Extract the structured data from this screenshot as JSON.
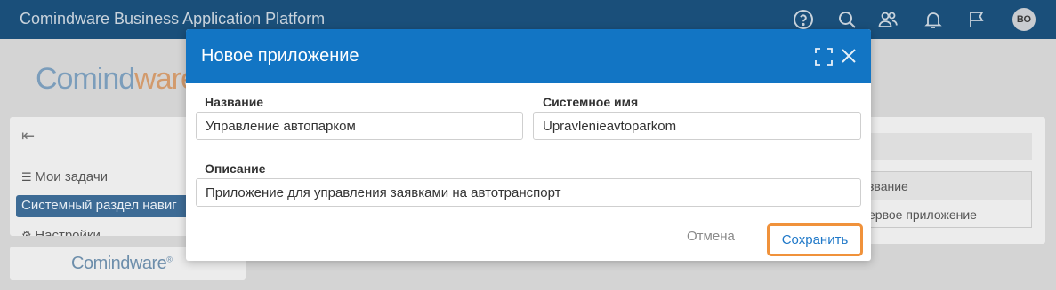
{
  "app": {
    "title": "Comindware Business Application Platform",
    "user_initials": "ВО"
  },
  "header_icons": [
    "help-icon",
    "search-icon",
    "users-icon",
    "bell-icon",
    "flag-icon"
  ],
  "background": {
    "logo_part1": "Comind",
    "logo_part2": "ware",
    "nav": {
      "my_tasks": "Мои задачи",
      "system_section": "Системный раздел навиг",
      "settings": "Настройки"
    },
    "footer_logo": "Comindware",
    "table_header": "звание",
    "table_row": "ервое приложение"
  },
  "modal": {
    "title": "Новое приложение",
    "name_label": "Название",
    "name_value": "Управление автопарком",
    "system_name_label": "Системное имя",
    "system_name_value": "Upravlenieavtoparkom",
    "description_label": "Описание",
    "description_value": "Приложение для управления заявками на автотранспорт",
    "cancel_label": "Отмена",
    "save_label": "Сохранить"
  },
  "colors": {
    "topbar": "#1a4f7a",
    "modal_header": "#1275c4",
    "save_highlight": "#f0923b",
    "link_blue": "#1f78c8"
  }
}
